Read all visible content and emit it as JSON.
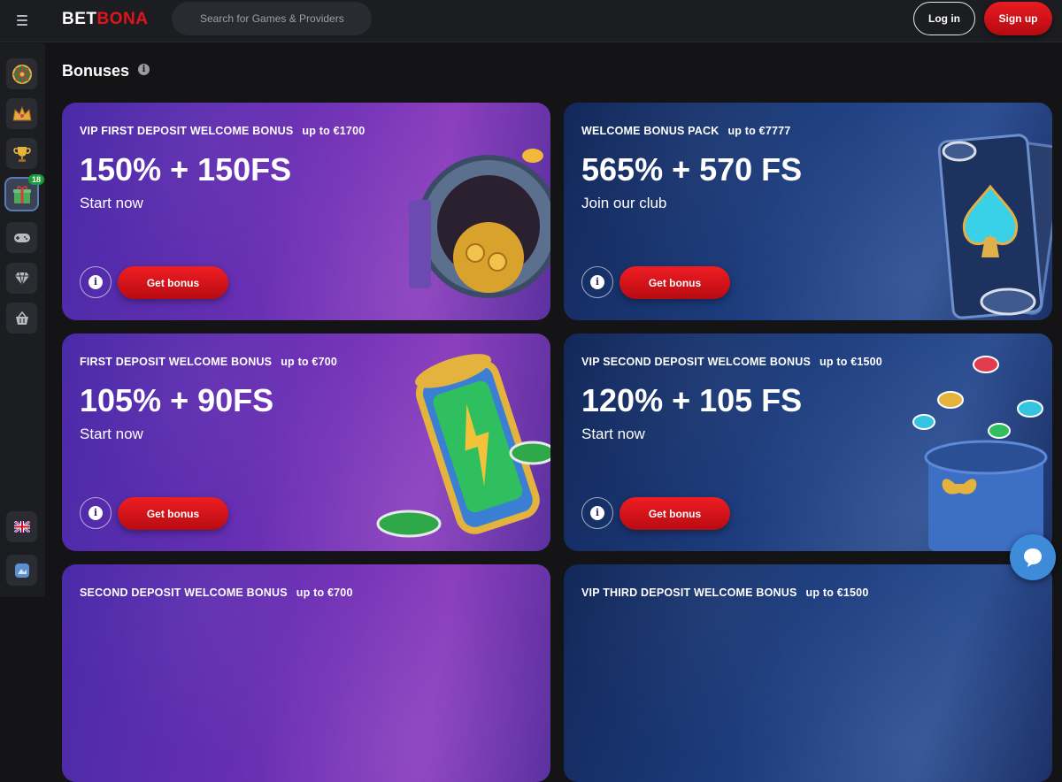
{
  "header": {
    "logo_bet": "BET",
    "logo_bona": "BONA",
    "search_placeholder": "Search for Games & Providers",
    "login_label": "Log in",
    "signup_label": "Sign up"
  },
  "sidebar": {
    "items": [
      {
        "icon": "wheel-icon"
      },
      {
        "icon": "crown-icon"
      },
      {
        "icon": "trophy-icon"
      },
      {
        "icon": "gift-icon",
        "badge": "18"
      },
      {
        "icon": "gamepad-icon"
      },
      {
        "icon": "diamond-icon"
      },
      {
        "icon": "basket-icon"
      }
    ],
    "bottom_items": [
      {
        "icon": "uk-flag-icon"
      },
      {
        "icon": "app-icon"
      }
    ]
  },
  "page": {
    "title": "Bonuses"
  },
  "cards": [
    {
      "subtitle": "VIP FIRST DEPOSIT WELCOME BONUS",
      "upto": "up to €1700",
      "headline": "150% + 150FS",
      "cta": "Start now",
      "button": "Get bonus",
      "theme": "purple"
    },
    {
      "subtitle": "WELCOME BONUS PACK",
      "upto": "up to €7777",
      "headline": "565% + 570 FS",
      "cta": "Join our club",
      "button": "Get bonus",
      "theme": "blue"
    },
    {
      "subtitle": "FIRST DEPOSIT WELCOME BONUS",
      "upto": "up to €700",
      "headline": "105% + 90FS",
      "cta": "Start now",
      "button": "Get bonus",
      "theme": "purple"
    },
    {
      "subtitle": "VIP SECOND DEPOSIT WELCOME BONUS",
      "upto": "up to €1500",
      "headline": "120% + 105 FS",
      "cta": "Start now",
      "button": "Get bonus",
      "theme": "blue"
    },
    {
      "subtitle": "SECOND DEPOSIT WELCOME BONUS",
      "upto": "up to €700",
      "theme": "purple"
    },
    {
      "subtitle": "VIP THIRD DEPOSIT WELCOME BONUS",
      "upto": "up to €1500",
      "theme": "blue"
    }
  ],
  "colors": {
    "brand_red": "#e1141c",
    "background": "#141416",
    "header": "#1c1d21",
    "card_purple": "#6a2fb4",
    "card_blue": "#1d3d7e",
    "chat": "#3d8bd9"
  }
}
